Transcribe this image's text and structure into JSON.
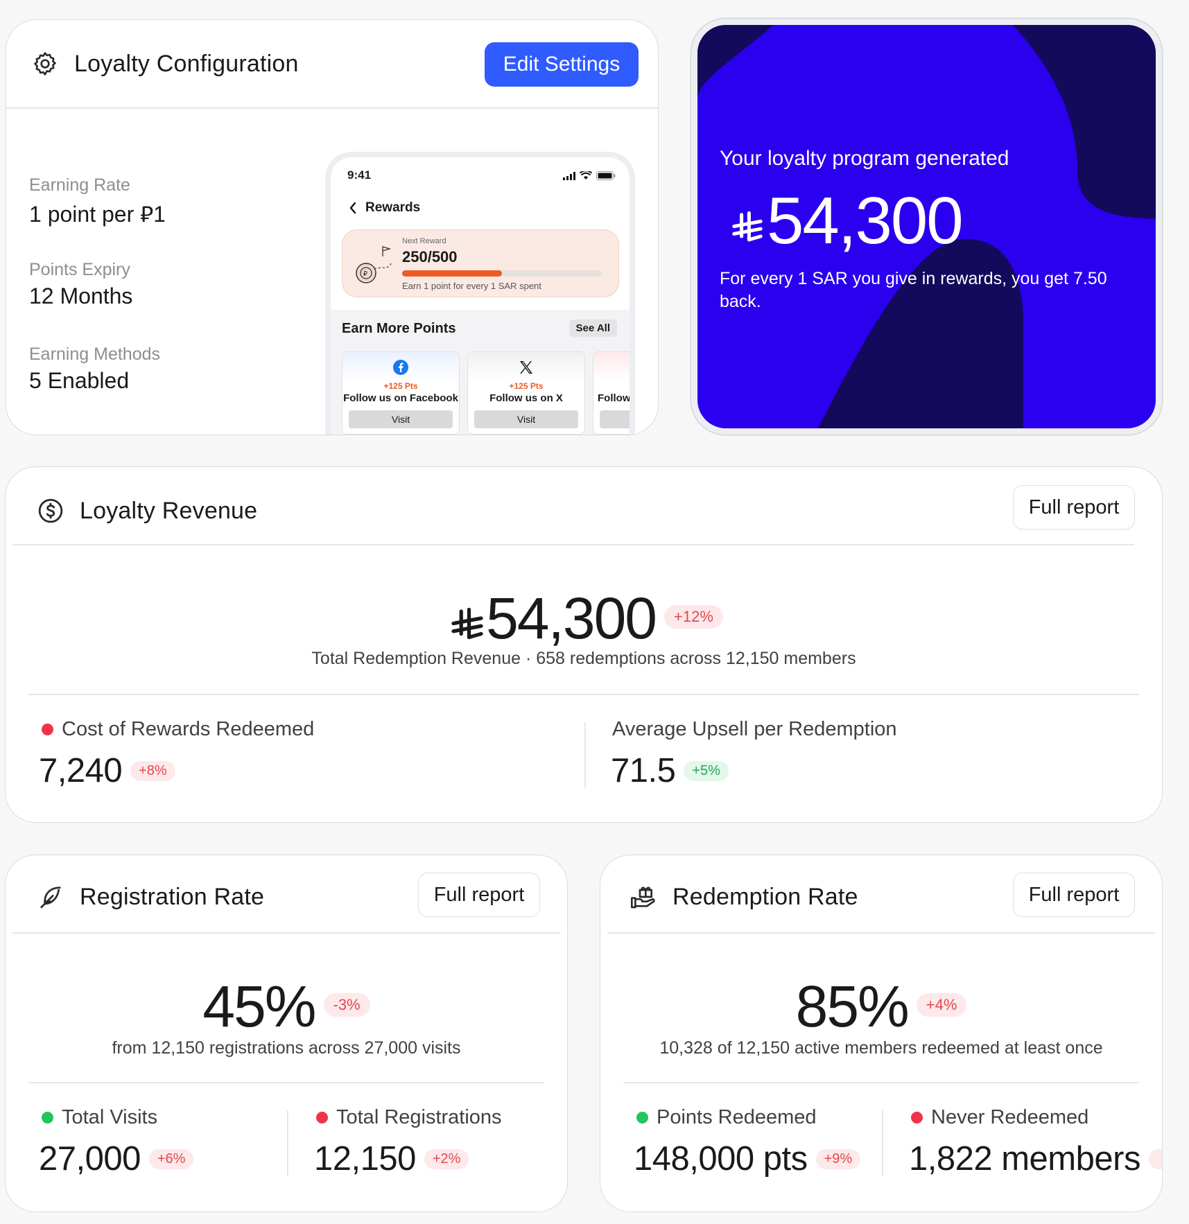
{
  "config": {
    "title": "Loyalty Configuration",
    "edit_button": "Edit Settings",
    "items": [
      {
        "label": "Earning Rate",
        "value": "1 point per  ⃁1"
      },
      {
        "label": "Points Expiry",
        "value": "12 Months"
      },
      {
        "label": "Earning Methods",
        "value": "5 Enabled"
      }
    ],
    "phone": {
      "time": "9:41",
      "back_label": "Rewards",
      "next_reward_kicker": "Next Reward",
      "next_reward_value": "250/500",
      "next_reward_progress": 0.5,
      "next_reward_sub": "Earn 1 point for every 1 SAR spent",
      "earn_more": "Earn More Points",
      "see_all": "See All",
      "tiles": [
        {
          "icon": "facebook-icon",
          "pts": "+125 Pts",
          "label": "Follow us on Facebook",
          "button": "Visit"
        },
        {
          "icon": "x-icon",
          "pts": "+125 Pts",
          "label": "Follow us on X",
          "button": "Visit"
        },
        {
          "icon": "",
          "pts": "",
          "label": "Follow",
          "button": ""
        }
      ]
    }
  },
  "promo": {
    "kicker": "Your loyalty program generated",
    "amount": "54,300",
    "sub": "For every 1 SAR you give in rewards, you get 7.50 back.",
    "colors": {
      "bg": "#2a00ee",
      "shape": "#130a5c"
    }
  },
  "revenue": {
    "title": "Loyalty Revenue",
    "report_button": "Full report",
    "amount": "54,300",
    "change": "+12%",
    "caption": "Total Redemption Revenue · 658 redemptions across 12,150 members",
    "stats": [
      {
        "label": "Cost of Rewards Redeemed",
        "value": "7,240",
        "change": "+8%",
        "dot": "red",
        "change_color": "red"
      },
      {
        "label": "Average Upsell per Redemption",
        "value": "71.5",
        "change": "+5%",
        "dot": "",
        "change_color": "green"
      }
    ]
  },
  "registration": {
    "title": "Registration Rate",
    "report_button": "Full report",
    "value": "45%",
    "change": "-3%",
    "caption": "from 12,150 registrations across 27,000 visits",
    "stats": [
      {
        "label": "Total Visits",
        "value": "27,000",
        "change": "+6%",
        "dot": "green"
      },
      {
        "label": "Total Registrations",
        "value": "12,150",
        "change": "+2%",
        "dot": "red"
      }
    ]
  },
  "redemption": {
    "title": "Redemption Rate",
    "report_button": "Full report",
    "value": "85%",
    "change": "+4%",
    "caption": "10,328 of 12,150 active members redeemed at least once",
    "stats": [
      {
        "label": "Points Redeemed",
        "value": "148,000 pts",
        "change": "+9%",
        "dot": "green"
      },
      {
        "label": "Never Redeemed",
        "value": "1,822 members",
        "change": "",
        "dot": "red"
      }
    ]
  },
  "colors": {
    "accent": "#2f5bff",
    "negative": "#e5484d",
    "positive": "#22a75a"
  }
}
